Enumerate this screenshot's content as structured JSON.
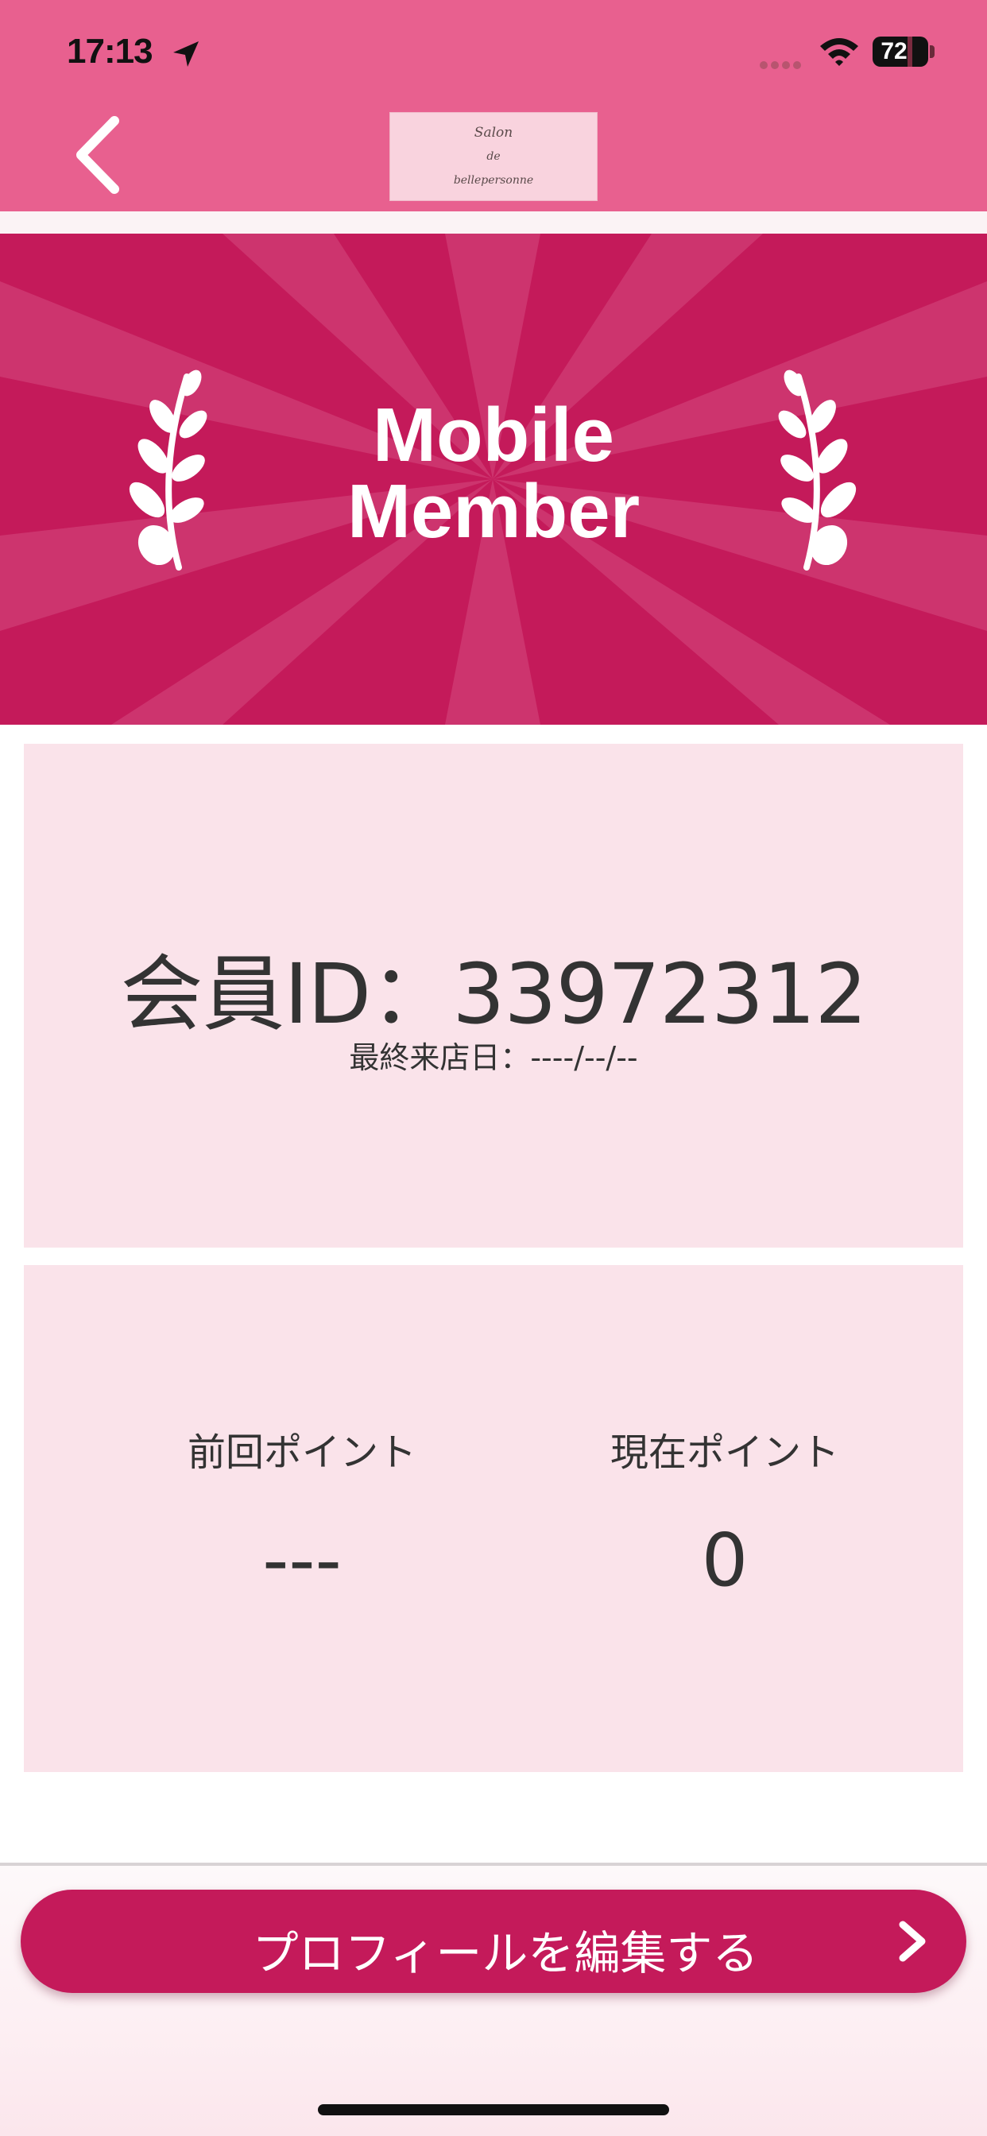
{
  "status_bar": {
    "time": "17:13",
    "battery": "72",
    "battery_level": 0.72,
    "icons": [
      "location-arrow-icon",
      "signal-dots-icon",
      "wifi-icon",
      "battery-icon"
    ]
  },
  "nav": {
    "back_icon": "chevron-left-icon",
    "logo": {
      "line1": "Salon",
      "line2": "de",
      "line3": "bellepersonne"
    }
  },
  "banner": {
    "title_line1": "Mobile",
    "title_line2": "Member",
    "icons": [
      "laurel-branch-left-icon",
      "laurel-branch-right-icon"
    ]
  },
  "member": {
    "id_text": "会員ID：33972312",
    "last_visit": "最終来店日：----/--/--"
  },
  "points": {
    "previous_label": "前回ポイント",
    "previous_value": "---",
    "current_label": "現在ポイント",
    "current_value": "0"
  },
  "footer": {
    "edit_profile_label": "プロフィールを編集する",
    "edit_icon": "chevron-right-icon"
  },
  "colors": {
    "header_pink": "#e8608f",
    "banner_magenta": "#c41a5a",
    "card_pink": "#fae3ea",
    "button_magenta": "#c41a5a"
  }
}
